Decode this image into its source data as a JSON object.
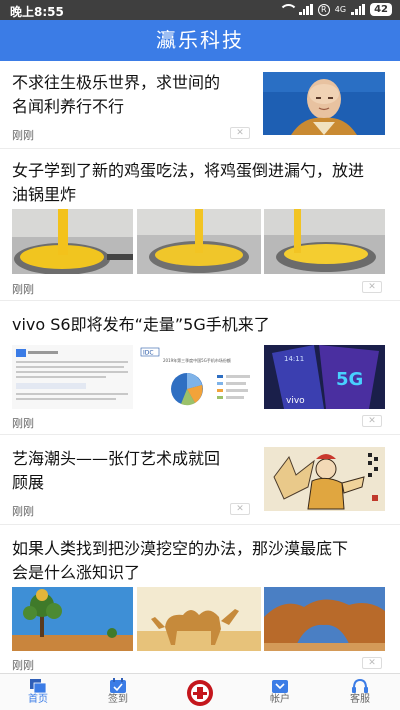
{
  "status_bar": {
    "time": "晚上8:55",
    "r_badge": "R",
    "network": "4G",
    "battery": "42"
  },
  "header": {
    "title": "瀛乐科技"
  },
  "articles": [
    {
      "title_line1": "不求往生极乐世界，求世间的",
      "title_line2": "名闻利养行不行",
      "meta": "刚刚",
      "dismiss": "✕"
    },
    {
      "title_line1": "女子学到了新的鸡蛋吃法，将鸡蛋倒进漏勺，放进",
      "title_line2": "油锅里炸",
      "meta": "刚刚",
      "dismiss": "✕"
    },
    {
      "title_line1": "vivo S6即将发布“走量”5G手机来了",
      "meta": "刚刚",
      "dismiss": "✕"
    },
    {
      "title_line1": "艺海潮头——张仃艺术成就回",
      "title_line2": "顾展",
      "meta": "刚刚",
      "dismiss": "✕"
    },
    {
      "title_line1": "如果人类找到把沙漠挖空的办法，那沙漠最底下",
      "title_line2": "会是什么涨知识了",
      "meta": "刚刚",
      "dismiss": "✕"
    }
  ],
  "thumbnails": {
    "vivo_chart_text": "2019年第三季度中国5G手机市场份额",
    "vivo_idc": "IDC",
    "vivo_5g": "5G",
    "vivo_logo": "vivo",
    "vivo_time": "14:11"
  },
  "tabbar": {
    "tabs": [
      {
        "label": "首页",
        "icon": "home-icon"
      },
      {
        "label": "签到",
        "icon": "calendar-check-icon"
      },
      {
        "label": "帐户",
        "icon": "account-icon"
      },
      {
        "label": "客服",
        "icon": "headset-icon"
      }
    ],
    "center_icon": "bank-logo-icon"
  },
  "colors": {
    "header_bg": "#3b7ce6",
    "status_bar_bg": "#3f3f3f",
    "active_tab": "#3b7ce6",
    "center_logo": "#c4161c"
  }
}
